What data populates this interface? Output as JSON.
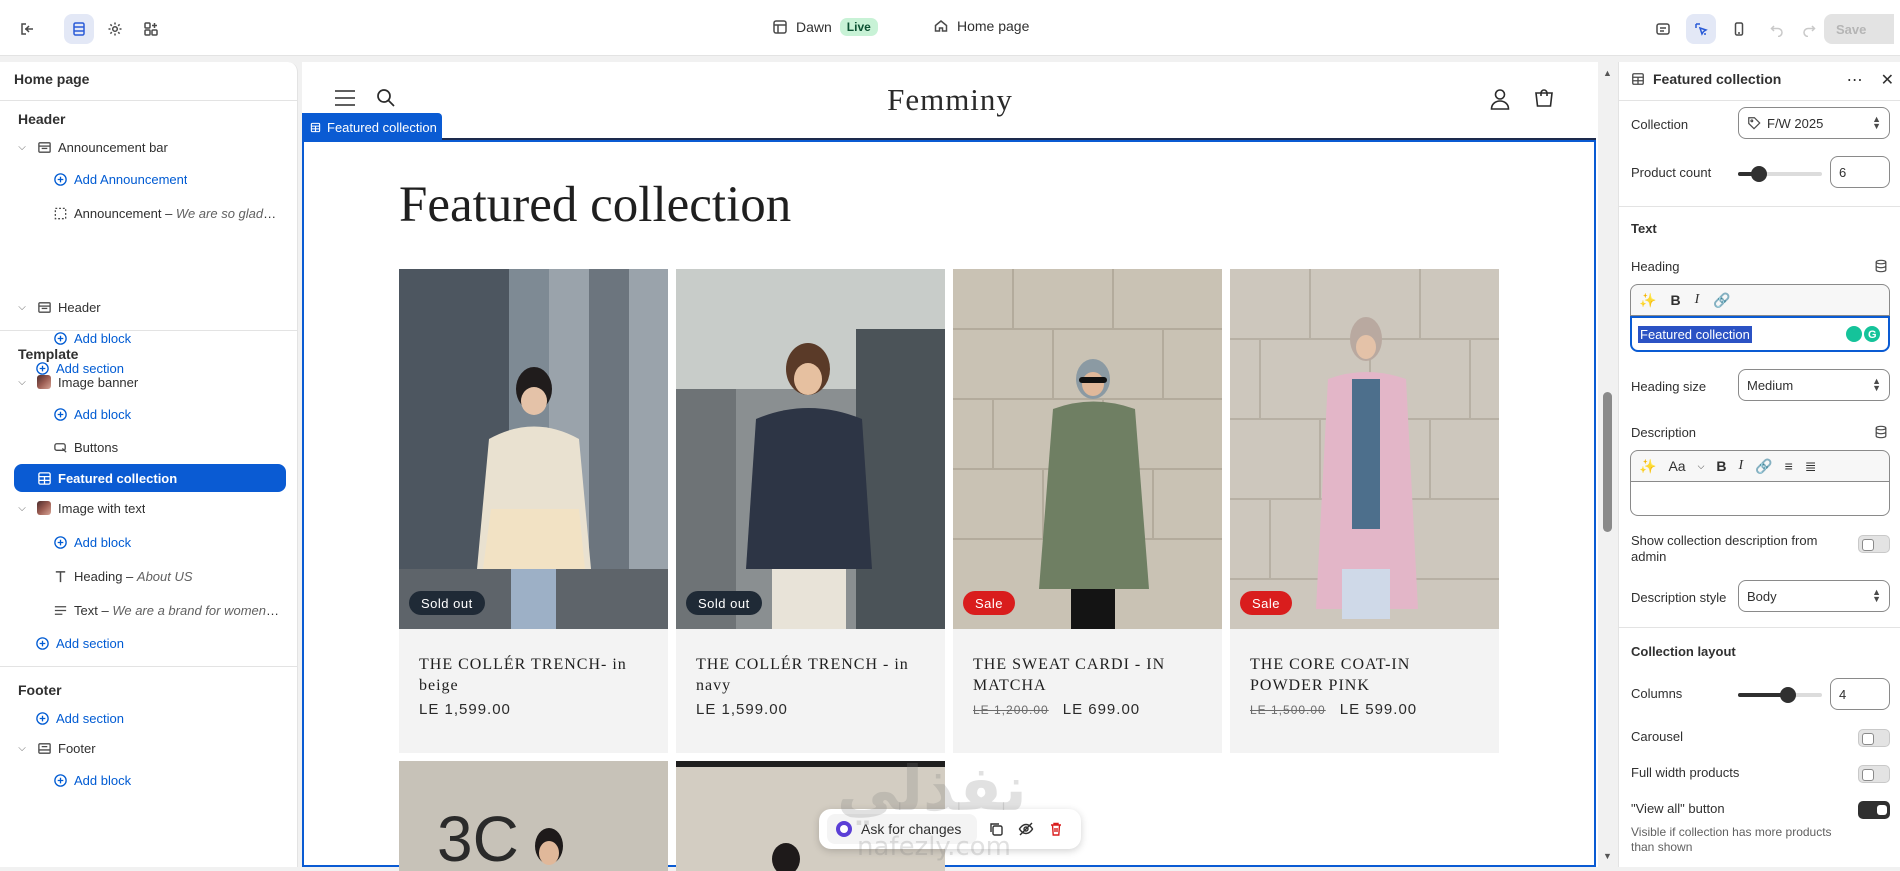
{
  "topbar": {
    "theme_name": "Dawn",
    "live_badge": "Live",
    "page_name": "Home page",
    "save_label": "Save"
  },
  "left_panel": {
    "title": "Home page",
    "groups": {
      "header": "Header",
      "template": "Template",
      "footer": "Footer"
    },
    "items": {
      "announcement_bar": "Announcement bar",
      "add_announcement": "Add Announcement",
      "announcement_label": "Announcement",
      "announcement_sub": "We are so glad t...",
      "header": "Header",
      "add_block_1": "Add block",
      "add_section_1": "Add section",
      "image_banner": "Image banner",
      "add_block_2": "Add block",
      "buttons": "Buttons",
      "featured_collection": "Featured collection",
      "image_with_text": "Image with text",
      "add_block_3": "Add block",
      "heading_label": "Heading",
      "heading_sub": "About US",
      "text_label": "Text",
      "text_sub": "We are a brand for women ...",
      "add_section_2": "Add section",
      "add_section_3": "Add section",
      "footer": "Footer",
      "add_block_4": "Add block"
    }
  },
  "preview": {
    "store_name": "Femminy",
    "section_tag": "Featured collection",
    "heading": "Featured collection",
    "products": [
      {
        "title": "THE COLLÉR TRENCH- in beige",
        "price": "LE 1,599.00",
        "old_price": "",
        "badge": "Sold out"
      },
      {
        "title": "THE COLLÉR TRENCH - in navy",
        "price": "LE 1,599.00",
        "old_price": "",
        "badge": "Sold out"
      },
      {
        "title": "THE SWEAT CARDI - IN MATCHA",
        "price": "LE 699.00",
        "old_price": "LE 1,200.00",
        "badge": "Sale"
      },
      {
        "title": "THE CORE COAT-IN POWDER PINK",
        "price": "LE 599.00",
        "old_price": "LE 1,500.00",
        "badge": "Sale"
      }
    ],
    "ask_placeholder": "Ask for changes"
  },
  "right_panel": {
    "title": "Featured collection",
    "collection_label": "Collection",
    "collection_value": "F/W 2025",
    "product_count_label": "Product count",
    "product_count_value": "6",
    "product_count_fraction": 0.25,
    "text_heading": "Text",
    "heading_label": "Heading",
    "heading_value": "Featured collection",
    "heading_size_label": "Heading size",
    "heading_size_value": "Medium",
    "description_label": "Description",
    "show_desc_label": "Show collection description from admin",
    "desc_style_label": "Description style",
    "desc_style_value": "Body",
    "layout_heading": "Collection layout",
    "columns_label": "Columns",
    "columns_value": "4",
    "columns_fraction": 0.6,
    "carousel_label": "Carousel",
    "full_width_label": "Full width products",
    "view_all_label": "\"View all\" button",
    "view_all_help": "Visible if collection has more products than shown",
    "text_size_icon": "Aa"
  },
  "watermark": {
    "latin": "nafezly.com"
  }
}
